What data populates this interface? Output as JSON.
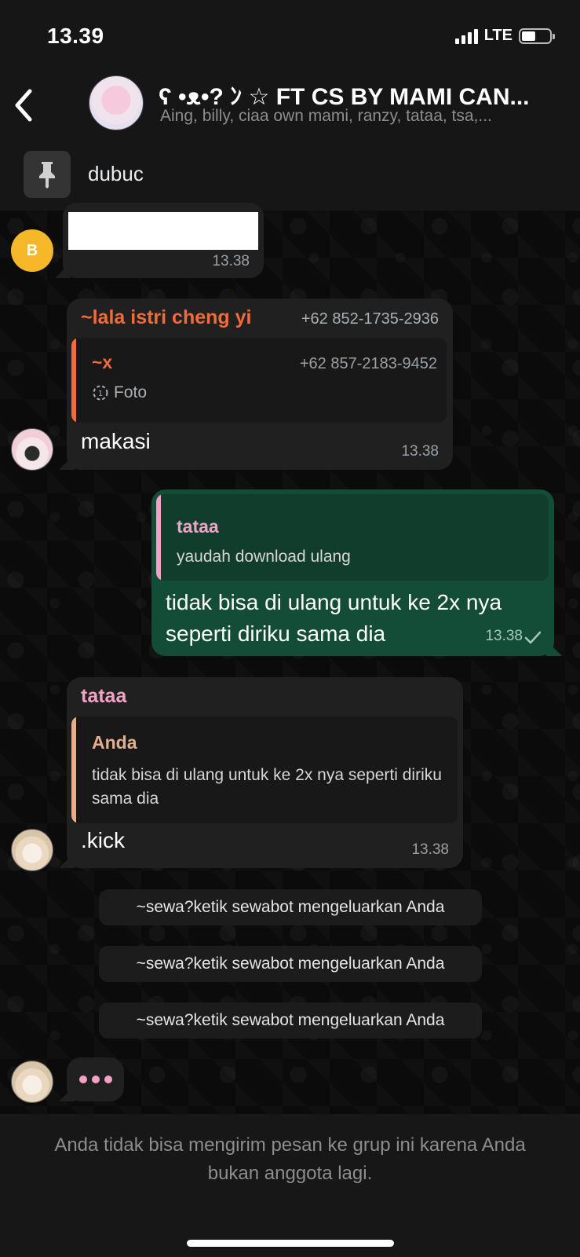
{
  "status_bar": {
    "time": "13.39",
    "network": "LTE",
    "battery_level": 0.5
  },
  "header": {
    "title": "ʕ •ᴥ•? ﾝ ☆ FT CS BY MAMI CAN...",
    "members": "Aing, billy, ciaa own mami, ranzy, tataa, tsa,..."
  },
  "pinned": {
    "text": "dubuc"
  },
  "messages": {
    "m1": {
      "avatar_letter": "B",
      "time": "13.38"
    },
    "m2": {
      "sender": "~lala istri cheng yi",
      "phone": "+62 852-1735-2936",
      "quote_name": "~x",
      "quote_phone": "+62 857-2183-9452",
      "quote_media": "Foto",
      "text": "makasi",
      "time": "13.38"
    },
    "m3": {
      "quote_name": "tataa",
      "quote_text": "yaudah download ulang",
      "text": "tidak bisa di ulang untuk ke 2x nya seperti diriku sama dia",
      "time": "13.38"
    },
    "m4": {
      "sender": "tataa",
      "quote_name": "Anda",
      "quote_text": "tidak bisa di ulang untuk ke 2x nya seperti diriku sama dia",
      "text": ".kick",
      "time": "13.38"
    }
  },
  "system_notes": [
    "~sewa?ketik sewabot mengeluarkan Anda",
    "~sewa?ketik sewabot mengeluarkan Anda",
    "~sewa?ketik sewabot mengeluarkan Anda"
  ],
  "footer": {
    "text": "Anda tidak bisa mengirim pesan ke grup ini karena Anda bukan anggota lagi."
  },
  "colors": {
    "accent_outgoing": "#144d37",
    "sender_lala": "#f26b3a",
    "sender_tataa": "#f2a2c6",
    "quote_anda": "#e6ae8a"
  }
}
